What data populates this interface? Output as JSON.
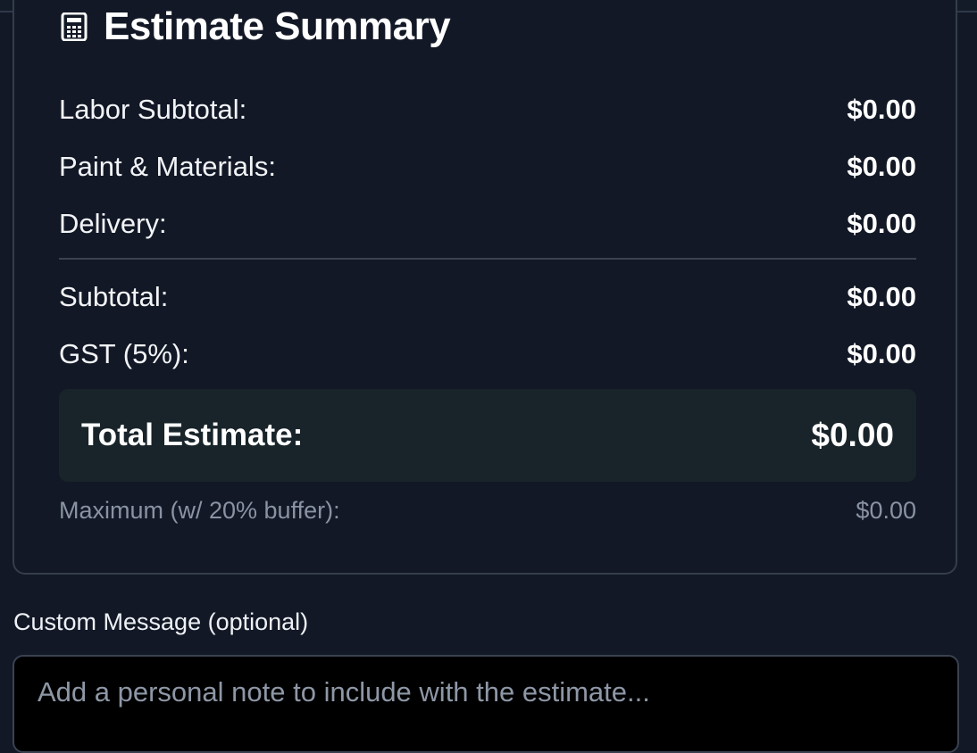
{
  "summary": {
    "title": "Estimate Summary",
    "icon": "calculator-icon",
    "rows": [
      {
        "label": "Labor Subtotal:",
        "value": "$0.00"
      },
      {
        "label": "Paint & Materials:",
        "value": "$0.00"
      },
      {
        "label": "Delivery:",
        "value": "$0.00"
      },
      {
        "label": "Subtotal:",
        "value": "$0.00"
      },
      {
        "label": "GST (5%):",
        "value": "$0.00"
      }
    ],
    "total": {
      "label": "Total Estimate:",
      "value": "$0.00"
    },
    "maximum": {
      "label": "Maximum (w/ 20% buffer):",
      "value": "$0.00"
    }
  },
  "custom_message": {
    "label": "Custom Message (optional)",
    "placeholder": "Add a personal note to include with the estimate...",
    "value": ""
  },
  "colors": {
    "background": "#121826",
    "total_box": "#18242a",
    "muted_text": "#8a93a3",
    "border": "#353d4c"
  }
}
